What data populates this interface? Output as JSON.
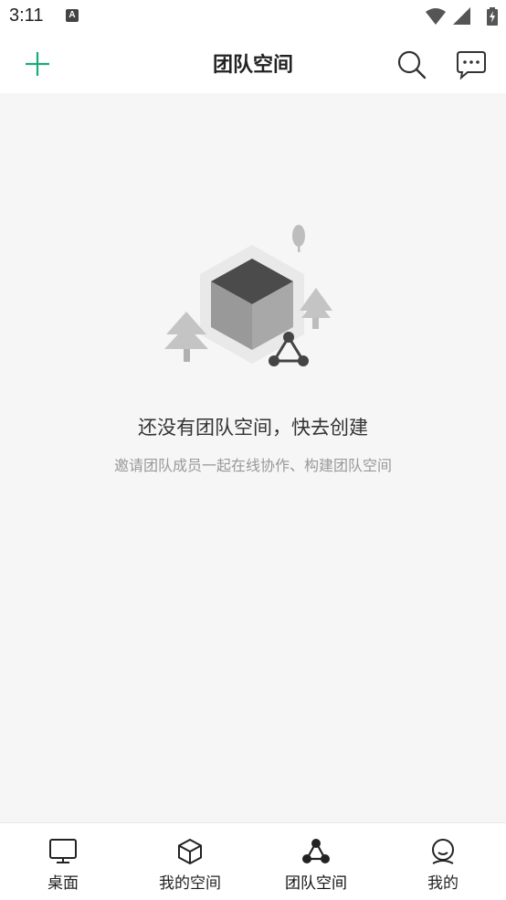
{
  "status_bar": {
    "time": "3:11",
    "app_icon_letter": "A"
  },
  "header": {
    "title": "团队空间",
    "icons": [
      "plus-icon",
      "search-icon",
      "message-icon"
    ],
    "accent_color": "#1aab7a"
  },
  "empty_state": {
    "title": "还没有团队空间，快去创建",
    "subtitle": "邀请团队成员一起在线协作、构建团队空间"
  },
  "tab_bar": {
    "tabs": [
      {
        "label": "桌面",
        "icon": "desktop-icon",
        "active": false
      },
      {
        "label": "我的空间",
        "icon": "cube-icon",
        "active": false
      },
      {
        "label": "团队空间",
        "icon": "team-icon",
        "active": true
      },
      {
        "label": "我的",
        "icon": "profile-icon",
        "active": false
      }
    ]
  }
}
